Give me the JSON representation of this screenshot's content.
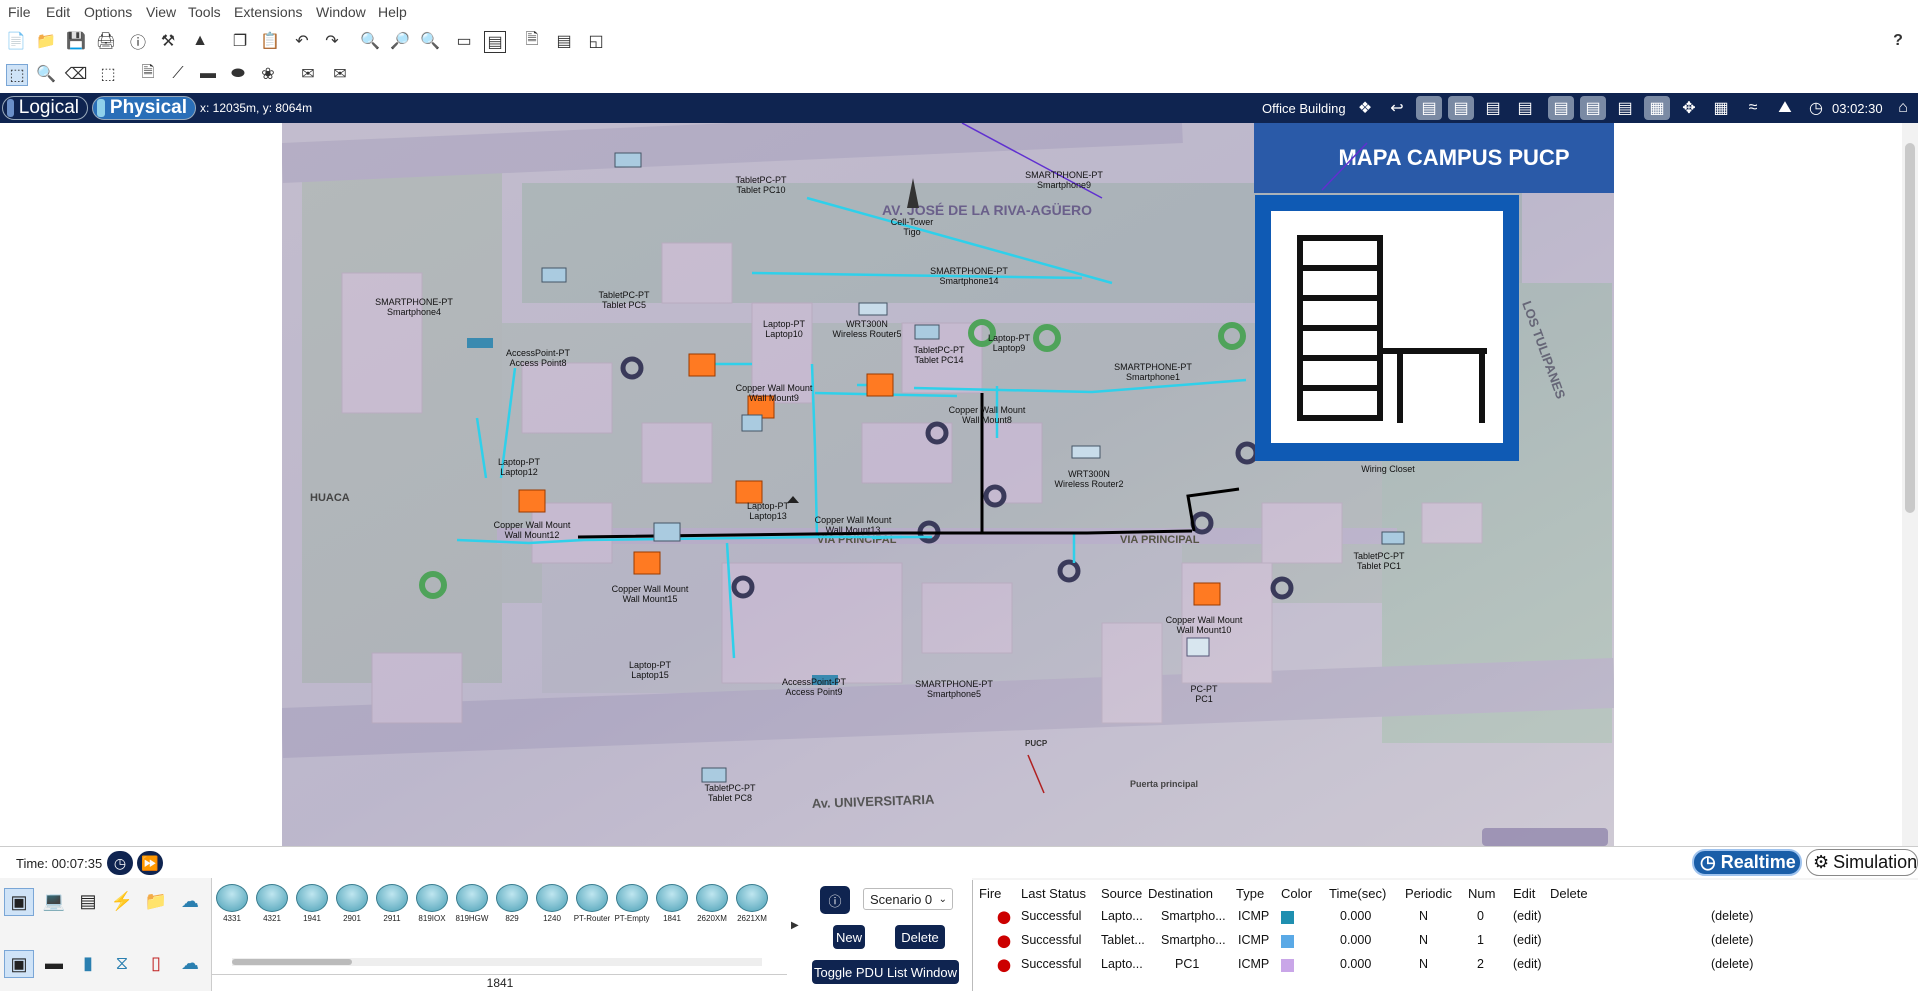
{
  "menu": [
    "File",
    "Edit",
    "Options",
    "View",
    "Tools",
    "Extensions",
    "Window",
    "Help"
  ],
  "help_glyph": "?",
  "modes": {
    "logical": "Logical",
    "physical": "Physical"
  },
  "coords": "x: 12035m, y: 8064m",
  "location": "Office Building",
  "clock": "03:02:30",
  "map": {
    "title": "MAPA CAMPUS PUCP",
    "streets": {
      "riva": "AV. JOSÉ DE LA RIVA-AGÜERO",
      "via1": "VIA PRINCIPAL",
      "via2": "VIA PRINCIPAL",
      "huaca": "HUACA",
      "univ": "Av. UNIVERSITARIA",
      "tulipanes": "LOS TULIPANES",
      "puerta": "Puerta principal",
      "pucp_sign": "PUCP"
    },
    "devices": [
      {
        "t": "TabletPC-PT",
        "n": "Tablet PC10"
      },
      {
        "t": "SMARTPHONE-PT",
        "n": "Smartphone9"
      },
      {
        "t": "Cell-Tower",
        "n": "Tigo"
      },
      {
        "t": "SMARTPHONE-PT",
        "n": "Smartphone4"
      },
      {
        "t": "TabletPC-PT",
        "n": "Tablet PC5"
      },
      {
        "t": "SMARTPHONE-PT",
        "n": "Smartphone14"
      },
      {
        "t": "Laptop-PT",
        "n": "Laptop10"
      },
      {
        "t": "WRT300N",
        "n": "Wireless Router5"
      },
      {
        "t": "TabletPC-PT",
        "n": "Tablet PC14"
      },
      {
        "t": "Laptop-PT",
        "n": "Laptop9"
      },
      {
        "t": "AccessPoint-PT",
        "n": "Access Point8"
      },
      {
        "t": "Copper Wall Mount",
        "n": "Wall Mount9"
      },
      {
        "t": "Copper Wall Mount",
        "n": "Wall Mount8"
      },
      {
        "t": "SMARTPHONE-PT",
        "n": "Smartphone1"
      },
      {
        "t": "Laptop-PT",
        "n": "Laptop12"
      },
      {
        "t": "WRT300N",
        "n": "Wireless Router2"
      },
      {
        "t": "Laptop-PT",
        "n": "Laptop13"
      },
      {
        "t": "Copper Wall Mount",
        "n": "Wall Mount13"
      },
      {
        "t": "Copper Wall Mount",
        "n": "Wall Mount12"
      },
      {
        "t": "Copper Wall Mount",
        "n": "Wall Mount15"
      },
      {
        "t": "TabletPC-PT",
        "n": "Tablet PC1"
      },
      {
        "t": "Copper Wall Mount",
        "n": "Wall Mount10"
      },
      {
        "t": "Laptop-PT",
        "n": "Laptop15"
      },
      {
        "t": "AccessPoint-PT",
        "n": "Access Point9"
      },
      {
        "t": "SMARTPHONE-PT",
        "n": "Smartphone5"
      },
      {
        "t": "PC-PT",
        "n": "PC1"
      },
      {
        "t": "TabletPC-PT",
        "n": "Tablet PC8"
      },
      {
        "t": "",
        "n": "Wiring Closet"
      }
    ]
  },
  "time": "Time: 00:07:35",
  "realtime": "Realtime",
  "simulation": "Simulation",
  "device_models": [
    "4331",
    "4321",
    "1941",
    "2901",
    "2911",
    "819IOX",
    "819HGW",
    "829",
    "1240",
    "PT-Router",
    "PT-Empty",
    "1841",
    "2620XM",
    "2621XM"
  ],
  "selected_model": "1841",
  "scenario": "Scenario 0",
  "new_btn": "New",
  "delete_btn": "Delete",
  "toggle_btn": "Toggle PDU List Window",
  "pdu_headers": [
    "Fire",
    "Last Status",
    "Source",
    "Destination",
    "Type",
    "Color",
    "Time(sec)",
    "Periodic",
    "Num",
    "Edit",
    "Delete"
  ],
  "pdu_rows": [
    {
      "status": "Successful",
      "source": "Lapto...",
      "dest": "Smartpho...",
      "type": "ICMP",
      "color": "#1f8fb0",
      "time": "0.000",
      "periodic": "N",
      "num": "0",
      "edit": "(edit)",
      "del": "(delete)"
    },
    {
      "status": "Successful",
      "source": "Tablet...",
      "dest": "Smartpho...",
      "type": "ICMP",
      "color": "#5aa9e6",
      "time": "0.000",
      "periodic": "N",
      "num": "1",
      "edit": "(edit)",
      "del": "(delete)"
    },
    {
      "status": "Successful",
      "source": "Lapto...",
      "dest": "PC1",
      "type": "ICMP",
      "color": "#c9a6e8",
      "time": "0.000",
      "periodic": "N",
      "num": "2",
      "edit": "(edit)",
      "del": "(delete)"
    }
  ],
  "colors": {
    "navy": "#0f2450",
    "cyan": "#29c7e0",
    "accent": "#1a5ea8"
  }
}
